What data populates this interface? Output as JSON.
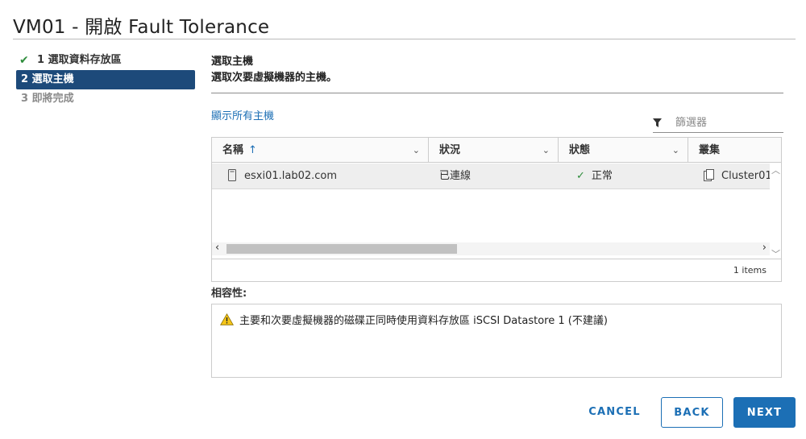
{
  "title": "VM01 - 開啟 Fault Tolerance",
  "steps": [
    {
      "label": "1 選取資料存放區",
      "state": "done"
    },
    {
      "label": "2 選取主機",
      "state": "active"
    },
    {
      "label": "3 即將完成",
      "state": "pending"
    }
  ],
  "main": {
    "heading": "選取主機",
    "subheading": "選取次要虛擬機器的主機。",
    "show_all_link": "顯示所有主機",
    "filter_placeholder": "篩選器"
  },
  "grid": {
    "columns": [
      "名稱",
      "狀況",
      "狀態",
      "叢集"
    ],
    "sort_indicator": "↑",
    "rows": [
      {
        "name": "esxi01.lab02.com",
        "condition": "已連線",
        "status": "正常",
        "cluster": "Cluster01"
      }
    ],
    "item_count": "1 items"
  },
  "compatibility": {
    "label": "相容性:",
    "message": "主要和次要虛擬機器的磁碟正同時使用資料存放區 iSCSI Datastore 1 (不建議)"
  },
  "buttons": {
    "cancel": "CANCEL",
    "back": "BACK",
    "next": "NEXT"
  },
  "colors": {
    "accent": "#1c6fb5",
    "active_step": "#1d4a7a",
    "success": "#2f8d3c",
    "warning": "#f5c518"
  },
  "icons": [
    "check-icon",
    "filter-icon",
    "sort-up-icon",
    "chevron-down-icon",
    "host-icon",
    "cluster-icon",
    "warning-icon"
  ]
}
